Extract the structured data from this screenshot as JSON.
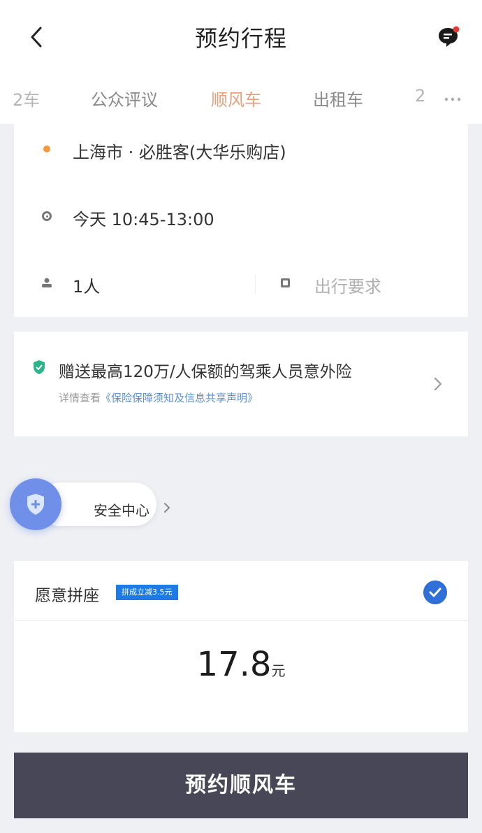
{
  "header": {
    "title": "预约行程",
    "back_icon": "chevron-left-icon",
    "message_icon": "message-bubble-icon",
    "notification_color": "#e53935"
  },
  "tabs": [
    {
      "label": "2车",
      "state": "partial"
    },
    {
      "label": "公众评议",
      "state": "normal"
    },
    {
      "label": "顺风车",
      "state": "active"
    },
    {
      "label": "出租车",
      "state": "normal"
    },
    {
      "label": "2",
      "state": "partial"
    }
  ],
  "accent_color": "#e6a07c",
  "trip": {
    "origin": "上海市 · 必胜客(大华乐购店)",
    "time": "今天 10:45-13:00",
    "passengers": "1人",
    "requirements_placeholder": "出行要求"
  },
  "insurance": {
    "title": "赠送最高120万/人保额的驾乘人员意外险",
    "subtitle_prefix": "详情查看",
    "subtitle_link": "《保险保障须知及信息共享声明》"
  },
  "safety": {
    "label": "安全中心"
  },
  "pool": {
    "label": "愿意拼座",
    "badge": "拼成立减3.5元",
    "checked": true,
    "price": "17.8",
    "price_unit": "元"
  },
  "book_button": {
    "label": "预约顺风车"
  }
}
